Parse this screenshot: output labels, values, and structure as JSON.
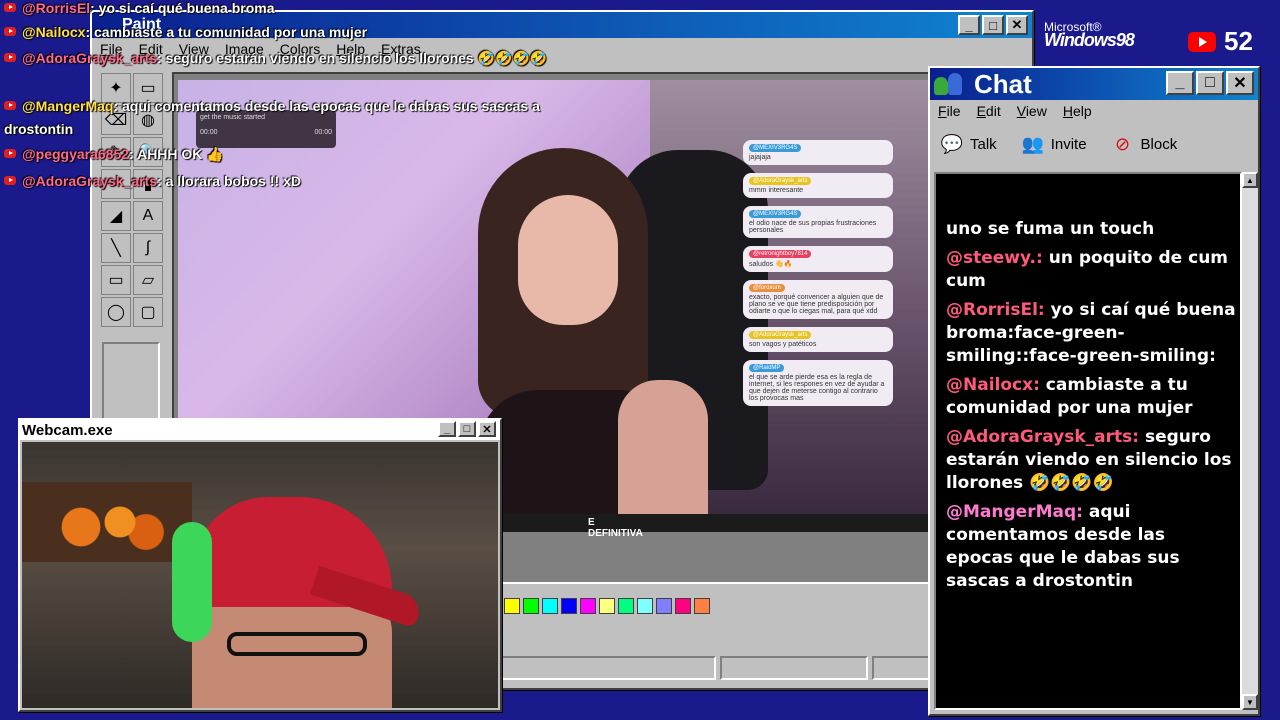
{
  "overlay_chat": [
    {
      "user": "@RorrisEl",
      "message": ": yo si caí qué buena broma",
      "user_color": "#ff6a8a"
    },
    {
      "user": "@Nailocx",
      "message": ": cambiaste a tu comunidad por una mujer",
      "user_color": "#ffe04a"
    },
    {
      "user": "@AdoraGraysk_arts",
      "message": ": seguro estarán viendo en silencio los llorones 🤣🤣🤣🤣",
      "user_color": "#ff6a8a"
    },
    {
      "user": "@MangerMaq",
      "message": ": aqui comentamos desde las epocas que le dabas sus sascas a",
      "user_color": "#ffe04a"
    },
    {
      "user": "",
      "message": "drostontin",
      "user_color": "#ffffff"
    },
    {
      "user": "@peggyara6852",
      "message": ": AHHH OK 👍",
      "user_color": "#ff6a8a"
    },
    {
      "user": "@AdoraGraysk_arts",
      "message": ": a llorara bobos !! xD",
      "user_color": "#ff6a8a"
    }
  ],
  "paint": {
    "title": "Paint",
    "menu": [
      "File",
      "Edit",
      "View",
      "Image",
      "Colors",
      "Help",
      "Extras"
    ],
    "tools": [
      "✦",
      "▭",
      "⌫",
      "◍",
      "✎",
      "🔍",
      "✏",
      "▮",
      "A",
      "◢",
      "╲",
      "∫",
      "▭",
      "▱",
      "◯",
      "▢"
    ],
    "stream_caption": "E DEFINITIVA",
    "palette": [
      "#ffff00",
      "#00ff00",
      "#00ffff",
      "#0000ff",
      "#ff00ff",
      "#ffff80",
      "#00ff80",
      "#80ffff",
      "#8080ff",
      "#ff0080",
      "#ff8040"
    ],
    "player": {
      "track": "get the music started",
      "time_start": "00:00",
      "time_end": "00:00"
    },
    "bubbles": [
      {
        "name": "@MEXIV3RG4S",
        "text": "jajajaja",
        "color": "#3a9ad8"
      },
      {
        "name": "@AdoraGraysk_arts",
        "text": "mmm interesante",
        "color": "#e8c420"
      },
      {
        "name": "@MEXIV3RG4S",
        "text": "el odio nace de sus propias frustraciones personales",
        "color": "#3a9ad8"
      },
      {
        "name": "@retronightboy7814",
        "text": "saludos 👋🔥",
        "color": "#e84060"
      },
      {
        "name": "@foroxum",
        "text": "exacto, porqué convencer a alguien que de plano se ve que tiene predisposición por odiarte o que lo ciegas mal, para qué xdd",
        "color": "#e89040"
      },
      {
        "name": "@AdoraGraysk_arts",
        "text": "son vagos y patéticos",
        "color": "#e8c420"
      },
      {
        "name": "@RaidMP",
        "text": "el que se arde pierde esa es la regla de internet, si les respones en vez de ayudar a que dejen de meterse contigo al contrario los provocas mas",
        "color": "#3a9ad8"
      }
    ]
  },
  "webcam": {
    "title": "Webcam.exe"
  },
  "chat": {
    "title": "Chat",
    "menu": [
      "File",
      "Edit",
      "View",
      "Help"
    ],
    "toolbar": [
      {
        "label": "Talk",
        "icon": "talk-icon"
      },
      {
        "label": "Invite",
        "icon": "invite-icon"
      },
      {
        "label": "Block",
        "icon": "block-icon"
      }
    ],
    "messages": [
      {
        "user": "",
        "text": "uno se fuma un touch",
        "color": "#ffffff"
      },
      {
        "user": "@steewy.:",
        "text": " un poquito de cum cum",
        "color": "#ff5a7a"
      },
      {
        "user": "@RorrisEl:",
        "text": " yo si caí qué buena broma:face-green-smiling::face-green-smiling:",
        "color": "#ff5a7a"
      },
      {
        "user": "@Nailocx:",
        "text": " cambiaste a tu comunidad por una mujer",
        "color": "#ff5a7a"
      },
      {
        "user": "@AdoraGraysk_arts:",
        "text": " seguro estarán viendo en silencio los llorones 🤣🤣🤣🤣",
        "color": "#ff5a7a"
      },
      {
        "user": "@MangerMaq:",
        "text": " aqui comentamos desde las epocas que le dabas sus sascas a drostontin",
        "color": "#ff7ad0"
      }
    ]
  },
  "brand": {
    "microsoft": "Microsoft®",
    "windows": "Windows98"
  },
  "viewers": {
    "count": "52"
  }
}
